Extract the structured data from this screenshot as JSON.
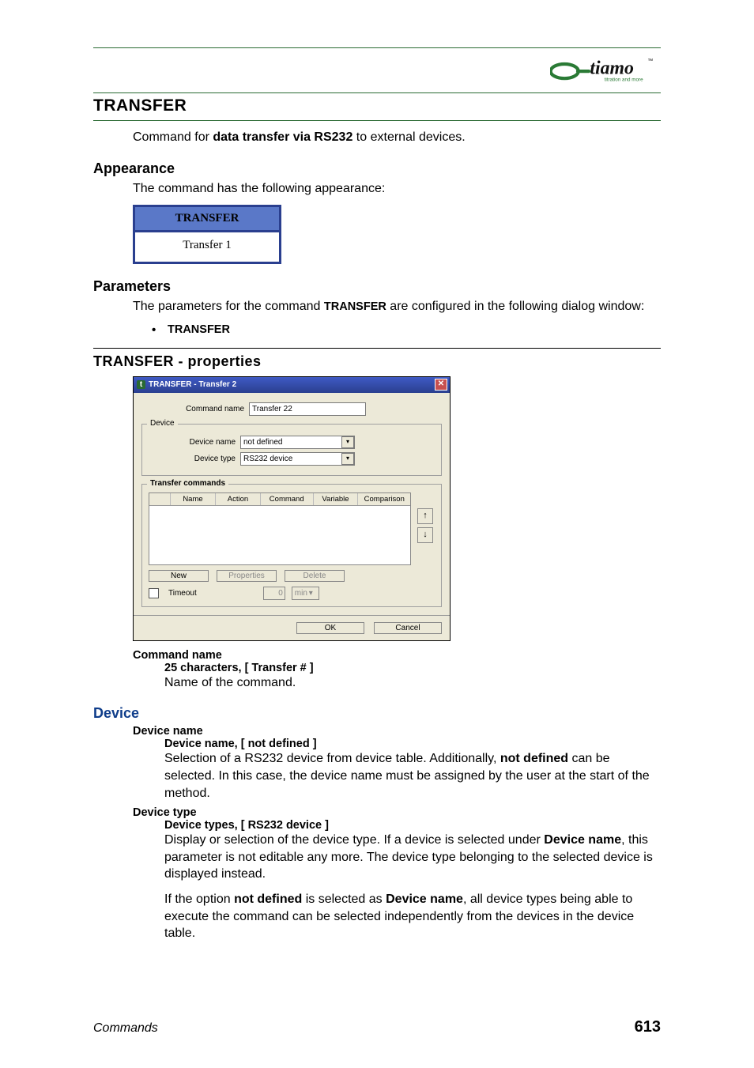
{
  "logo": {
    "brand": "tiamo",
    "tm": "™",
    "tagline": "titration and more"
  },
  "h1": "TRANSFER",
  "intro": {
    "pre": "Command for ",
    "bold": "data transfer via RS232",
    "post": " to external devices."
  },
  "appearance": {
    "title": "Appearance",
    "text": "The command has the following appearance:",
    "block_head": "TRANSFER",
    "block_body": "Transfer 1"
  },
  "parameters": {
    "title": "Parameters",
    "text_pre": "The parameters for the command ",
    "text_bold": "TRANSFER",
    "text_post": " are configured in the following dialog window:",
    "bullet": "TRANSFER"
  },
  "properties_title": "TRANSFER - properties",
  "dialog": {
    "title": "TRANSFER - Transfer 2",
    "cmd_name_label": "Command name",
    "cmd_name_value": "Transfer 22",
    "device_legend": "Device",
    "device_name_label": "Device name",
    "device_name_value": "not defined",
    "device_type_label": "Device type",
    "device_type_value": "RS232 device",
    "tc_legend": "Transfer commands",
    "tc_headers": [
      "Name",
      "Action",
      "Command",
      "Variable",
      "Comparison"
    ],
    "btn_new": "New",
    "btn_props": "Properties",
    "btn_delete": "Delete",
    "timeout_label": "Timeout",
    "timeout_value": "0",
    "timeout_unit": "min",
    "ok": "OK",
    "cancel": "Cancel"
  },
  "cmdname_section": {
    "h": "Command name",
    "spec": "25 characters, [ Transfer # ]",
    "desc": "Name of the command."
  },
  "device_section": {
    "title": "Device",
    "name_h": "Device name",
    "name_spec": "Device name, [ not defined ]",
    "name_desc_pre": "Selection of a RS232 device from device table. Additionally, ",
    "name_desc_bold": "not defined",
    "name_desc_post": " can be selected. In this case, the device name must be assigned by the user at the start of the method.",
    "type_h": "Device type",
    "type_spec": "Device types, [ RS232 device ]",
    "type_p1_pre": "Display or selection of the device type. If a device is selected under ",
    "type_p1_b1": "Device name",
    "type_p1_post": ", this parameter is not editable any more. The device type belonging to the selected device is displayed instead.",
    "type_p2_pre": "If the option ",
    "type_p2_b1": "not defined",
    "type_p2_mid": " is selected as ",
    "type_p2_b2": "Device name",
    "type_p2_post": ", all device types being able to execute the command can be selected independently from the devices in the device table."
  },
  "footer": {
    "section": "Commands",
    "page": "613"
  }
}
